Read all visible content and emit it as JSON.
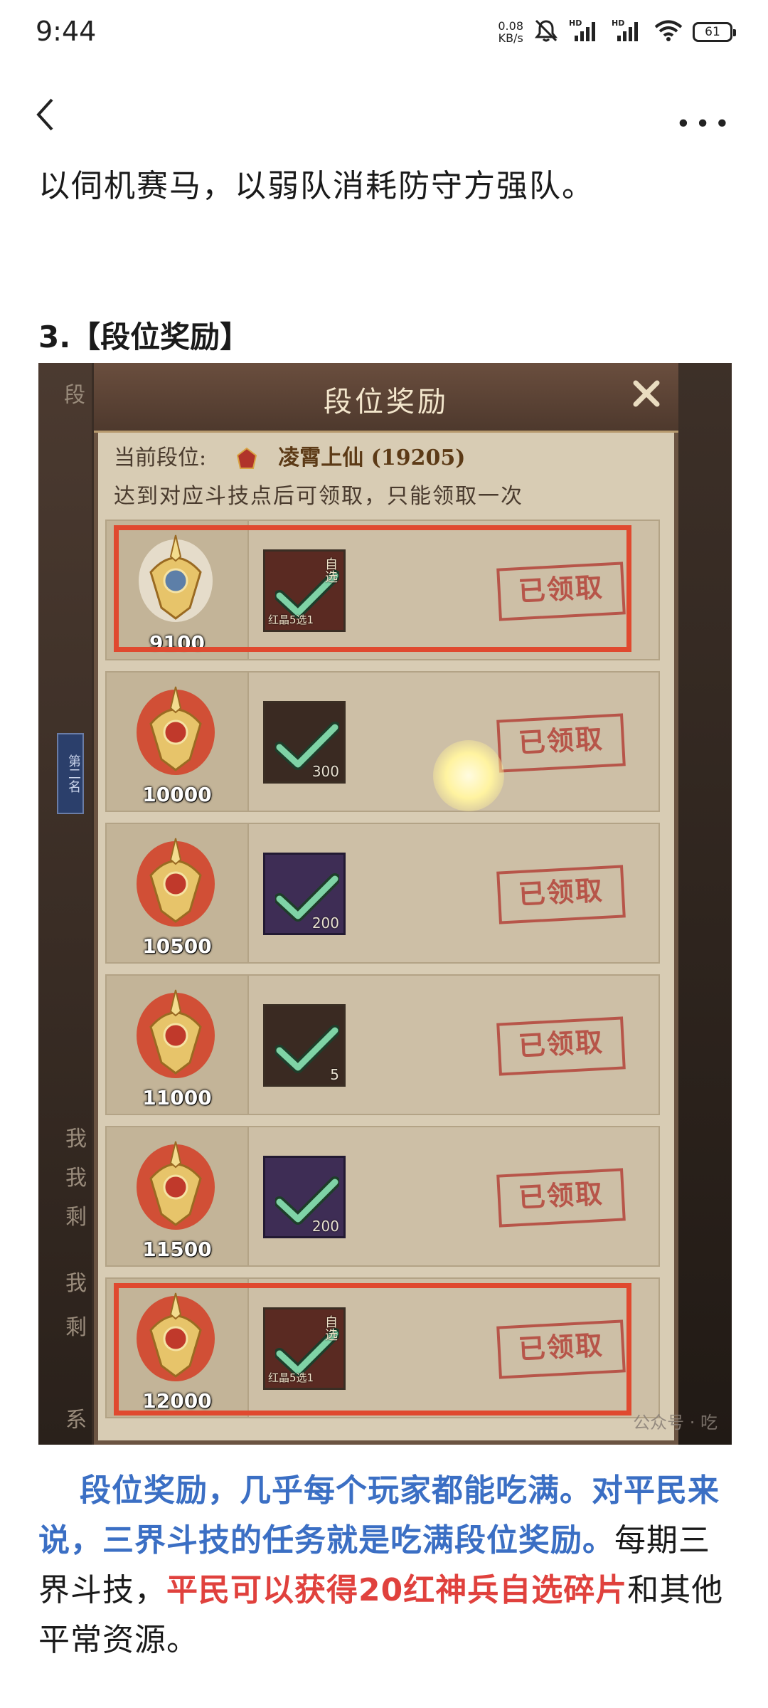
{
  "status_bar": {
    "time": "9:44",
    "net_speed_value": "0.08",
    "net_speed_unit": "KB/s",
    "battery": "61",
    "icons": [
      "mute-icon",
      "hd-signal-icon",
      "hd-signal-icon",
      "wifi-icon",
      "battery-icon"
    ]
  },
  "nav": {
    "back_icon": "chevron-left-icon",
    "more_label": "•••"
  },
  "article": {
    "para1": "以伺机赛马，以弱队消耗防守方强队。",
    "section_title": "3.【段位奖励】",
    "para2_blue": "段位奖励，几乎每个玩家都能吃满。对平民来说，三界斗技的任务就是吃满段位奖励。",
    "para2_mid": "每期三界斗技，",
    "para2_red": "平民可以获得20红神兵自选碎片",
    "para2_end": "和其他平常资源。"
  },
  "screenshot": {
    "title": "段位奖励",
    "current_rank_label": "当前段位:",
    "current_rank_value": "凌霄上仙 (19205)",
    "note": "达到对应斗技点后可领取，只能领取一次",
    "side_left_chars": [
      "段",
      "我",
      "我",
      "剩",
      "我",
      "剩",
      "系"
    ],
    "side_tag": "第二名",
    "watermark": "公众号 · 吃",
    "rows": [
      {
        "score": "9100",
        "item_qty": "",
        "item_label": "红晶5选1",
        "item_label2": "自选",
        "item_style": "red",
        "stamp": "已领取",
        "highlight": true
      },
      {
        "score": "10000",
        "item_qty": "300",
        "item_label": "",
        "item_label2": "",
        "item_style": "dark",
        "stamp": "已领取",
        "highlight": false
      },
      {
        "score": "10500",
        "item_qty": "200",
        "item_label": "",
        "item_label2": "",
        "item_style": "purple",
        "stamp": "已领取",
        "highlight": false
      },
      {
        "score": "11000",
        "item_qty": "5",
        "item_label": "",
        "item_label2": "",
        "item_style": "dark",
        "stamp": "已领取",
        "highlight": false
      },
      {
        "score": "11500",
        "item_qty": "200",
        "item_label": "",
        "item_label2": "",
        "item_style": "purple",
        "stamp": "已领取",
        "highlight": false
      },
      {
        "score": "12000",
        "item_qty": "",
        "item_label": "红晶5选1",
        "item_label2": "自选",
        "item_style": "red",
        "stamp": "已领取",
        "highlight": true
      }
    ]
  },
  "colors": {
    "highlight": "#e0492f",
    "blue_text": "#3b6fc4",
    "red_text": "#e0413d",
    "stamp": "#b5473d"
  }
}
